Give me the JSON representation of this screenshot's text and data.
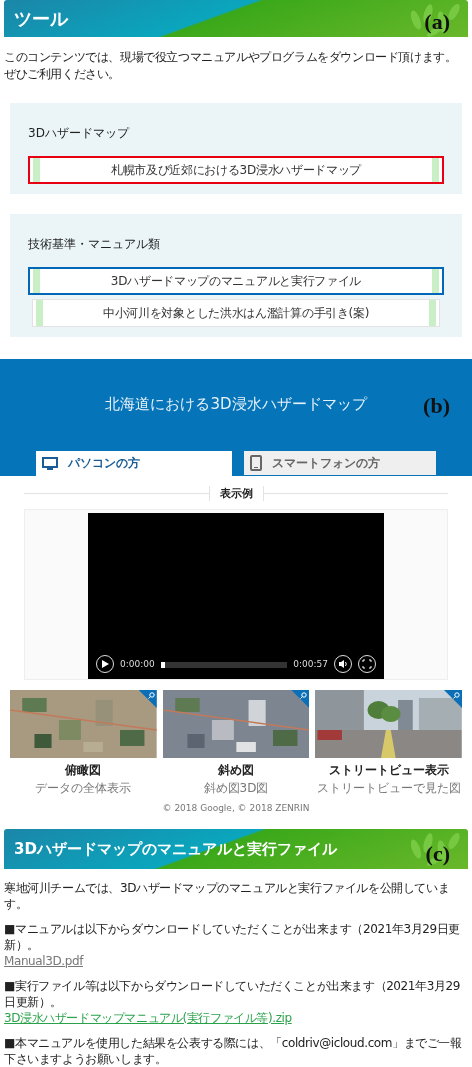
{
  "tools_header": {
    "title": "ツール",
    "label": "(a)"
  },
  "intro": [
    "このコンテンツでは、現場で役立つマニュアルやプログラムをダウンロード頂けます。",
    "ぜひご利用ください。"
  ],
  "panels": [
    {
      "heading": "3Dハザードマップ",
      "links": [
        {
          "label": "札幌市及び近郊における3D浸水ハザードマップ",
          "color": "#e60012"
        }
      ]
    },
    {
      "heading": "技術基準・マニュアル類",
      "links": [
        {
          "label": "3Dハザードマップのマニュアルと実行ファイル",
          "color": "#0068b7"
        },
        {
          "label": "中小河川を対象とした洪水はん濫計算の手引き(案)"
        }
      ]
    }
  ],
  "hero": {
    "title": "北海道における3D浸水ハザードマップ",
    "label": "(b)",
    "tabs": [
      {
        "label": "パソコンの方",
        "kind": "monitor",
        "selected": true
      },
      {
        "label": "スマートフォンの方",
        "kind": "phone",
        "selected": false
      }
    ]
  },
  "example": {
    "heading": "表示例",
    "video": {
      "current": "0:00:00",
      "duration": "0:00:57",
      "level": 0.03
    },
    "thumbnails": [
      {
        "title": "俯瞰図",
        "caption": "データの全体表示",
        "kind": "aerial"
      },
      {
        "title": "斜め図",
        "caption": "斜め図3D図",
        "kind": "oblique"
      },
      {
        "title": "ストリートビュー表示",
        "caption": "ストリートビューで見た図",
        "kind": "street"
      }
    ],
    "copyright": "© 2018 Google, © 2018 ZENRIN"
  },
  "manual_section": {
    "title": "3Dハザードマップのマニュアルと実行ファイル",
    "label": "(c)",
    "paragraphs": [
      {
        "text": "寒地河川チームでは、3Dハザードマップのマニュアルと実行ファイルを公開しています。"
      },
      {
        "text": "■マニュアルは以下からダウンロードしていただくことが出来ます（2021年3月29日更新）。",
        "link": {
          "label": "Manual3D.pdf",
          "visited": true
        }
      },
      {
        "text": "■実行ファイル等は以下からダウンロードしていただくことが出来ます（2021年3月29日更新）。",
        "link": {
          "label": "3D浸水ハザードマップマニュアル(実行ファイル等).zip",
          "visited": false
        }
      },
      {
        "text": "■本マニュアルを使用した結果を公表する際には、「coldriv@icloud.com」までご一報下さいますようお願いします。"
      }
    ]
  }
}
